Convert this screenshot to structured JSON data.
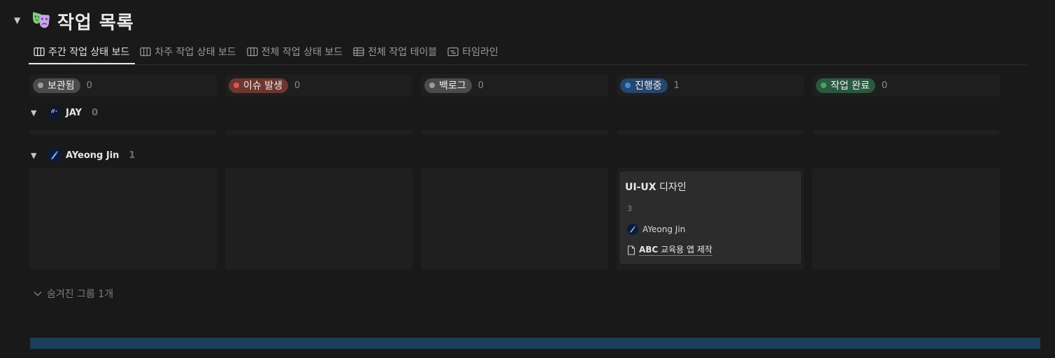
{
  "header": {
    "title": "작업 목록",
    "emoji": "performing-arts-masks",
    "toggle_icon": "triangle-down"
  },
  "tabs": [
    {
      "label": "주간 작업 상태 보드",
      "icon": "board-icon",
      "active": true
    },
    {
      "label": "차주 작업 상태 보드",
      "icon": "board-icon",
      "active": false
    },
    {
      "label": "전체 작업 상태 보드",
      "icon": "board-icon",
      "active": false
    },
    {
      "label": "전체 작업 테이블",
      "icon": "table-icon",
      "active": false
    },
    {
      "label": "타임라인",
      "icon": "timeline-icon",
      "active": false
    }
  ],
  "columns": [
    {
      "label": "보관됨",
      "count": "0",
      "pill_color": "#4b4b4b",
      "dot_color": "#9b9b9b"
    },
    {
      "label": "이슈 발생",
      "count": "0",
      "pill_color": "#6e3630",
      "dot_color": "#de5550"
    },
    {
      "label": "백로그",
      "count": "0",
      "pill_color": "#4b4b4b",
      "dot_color": "#9b9b9b"
    },
    {
      "label": "진행중",
      "count": "1",
      "pill_color": "#28456c",
      "dot_color": "#3a8be0"
    },
    {
      "label": "작업 완료",
      "count": "0",
      "pill_color": "#2b593f",
      "dot_color": "#3fa86a"
    }
  ],
  "groups": [
    {
      "name": "JAY",
      "count": "0"
    },
    {
      "name": "AYeong Jin",
      "count": "1"
    }
  ],
  "card": {
    "title_bold": "UI-UX",
    "title_rest": " 디자인",
    "number": "3",
    "person": "AYeong Jin",
    "relation_bold": "ABC",
    "relation_rest": " 교육용 앱 제작"
  },
  "hidden_groups_label": "숨겨진 그룹 1개",
  "colors": {
    "background": "#191919",
    "card": "#2c2c2c",
    "cell": "#1f1f1f",
    "bottom_bar": "#1b3e59"
  }
}
